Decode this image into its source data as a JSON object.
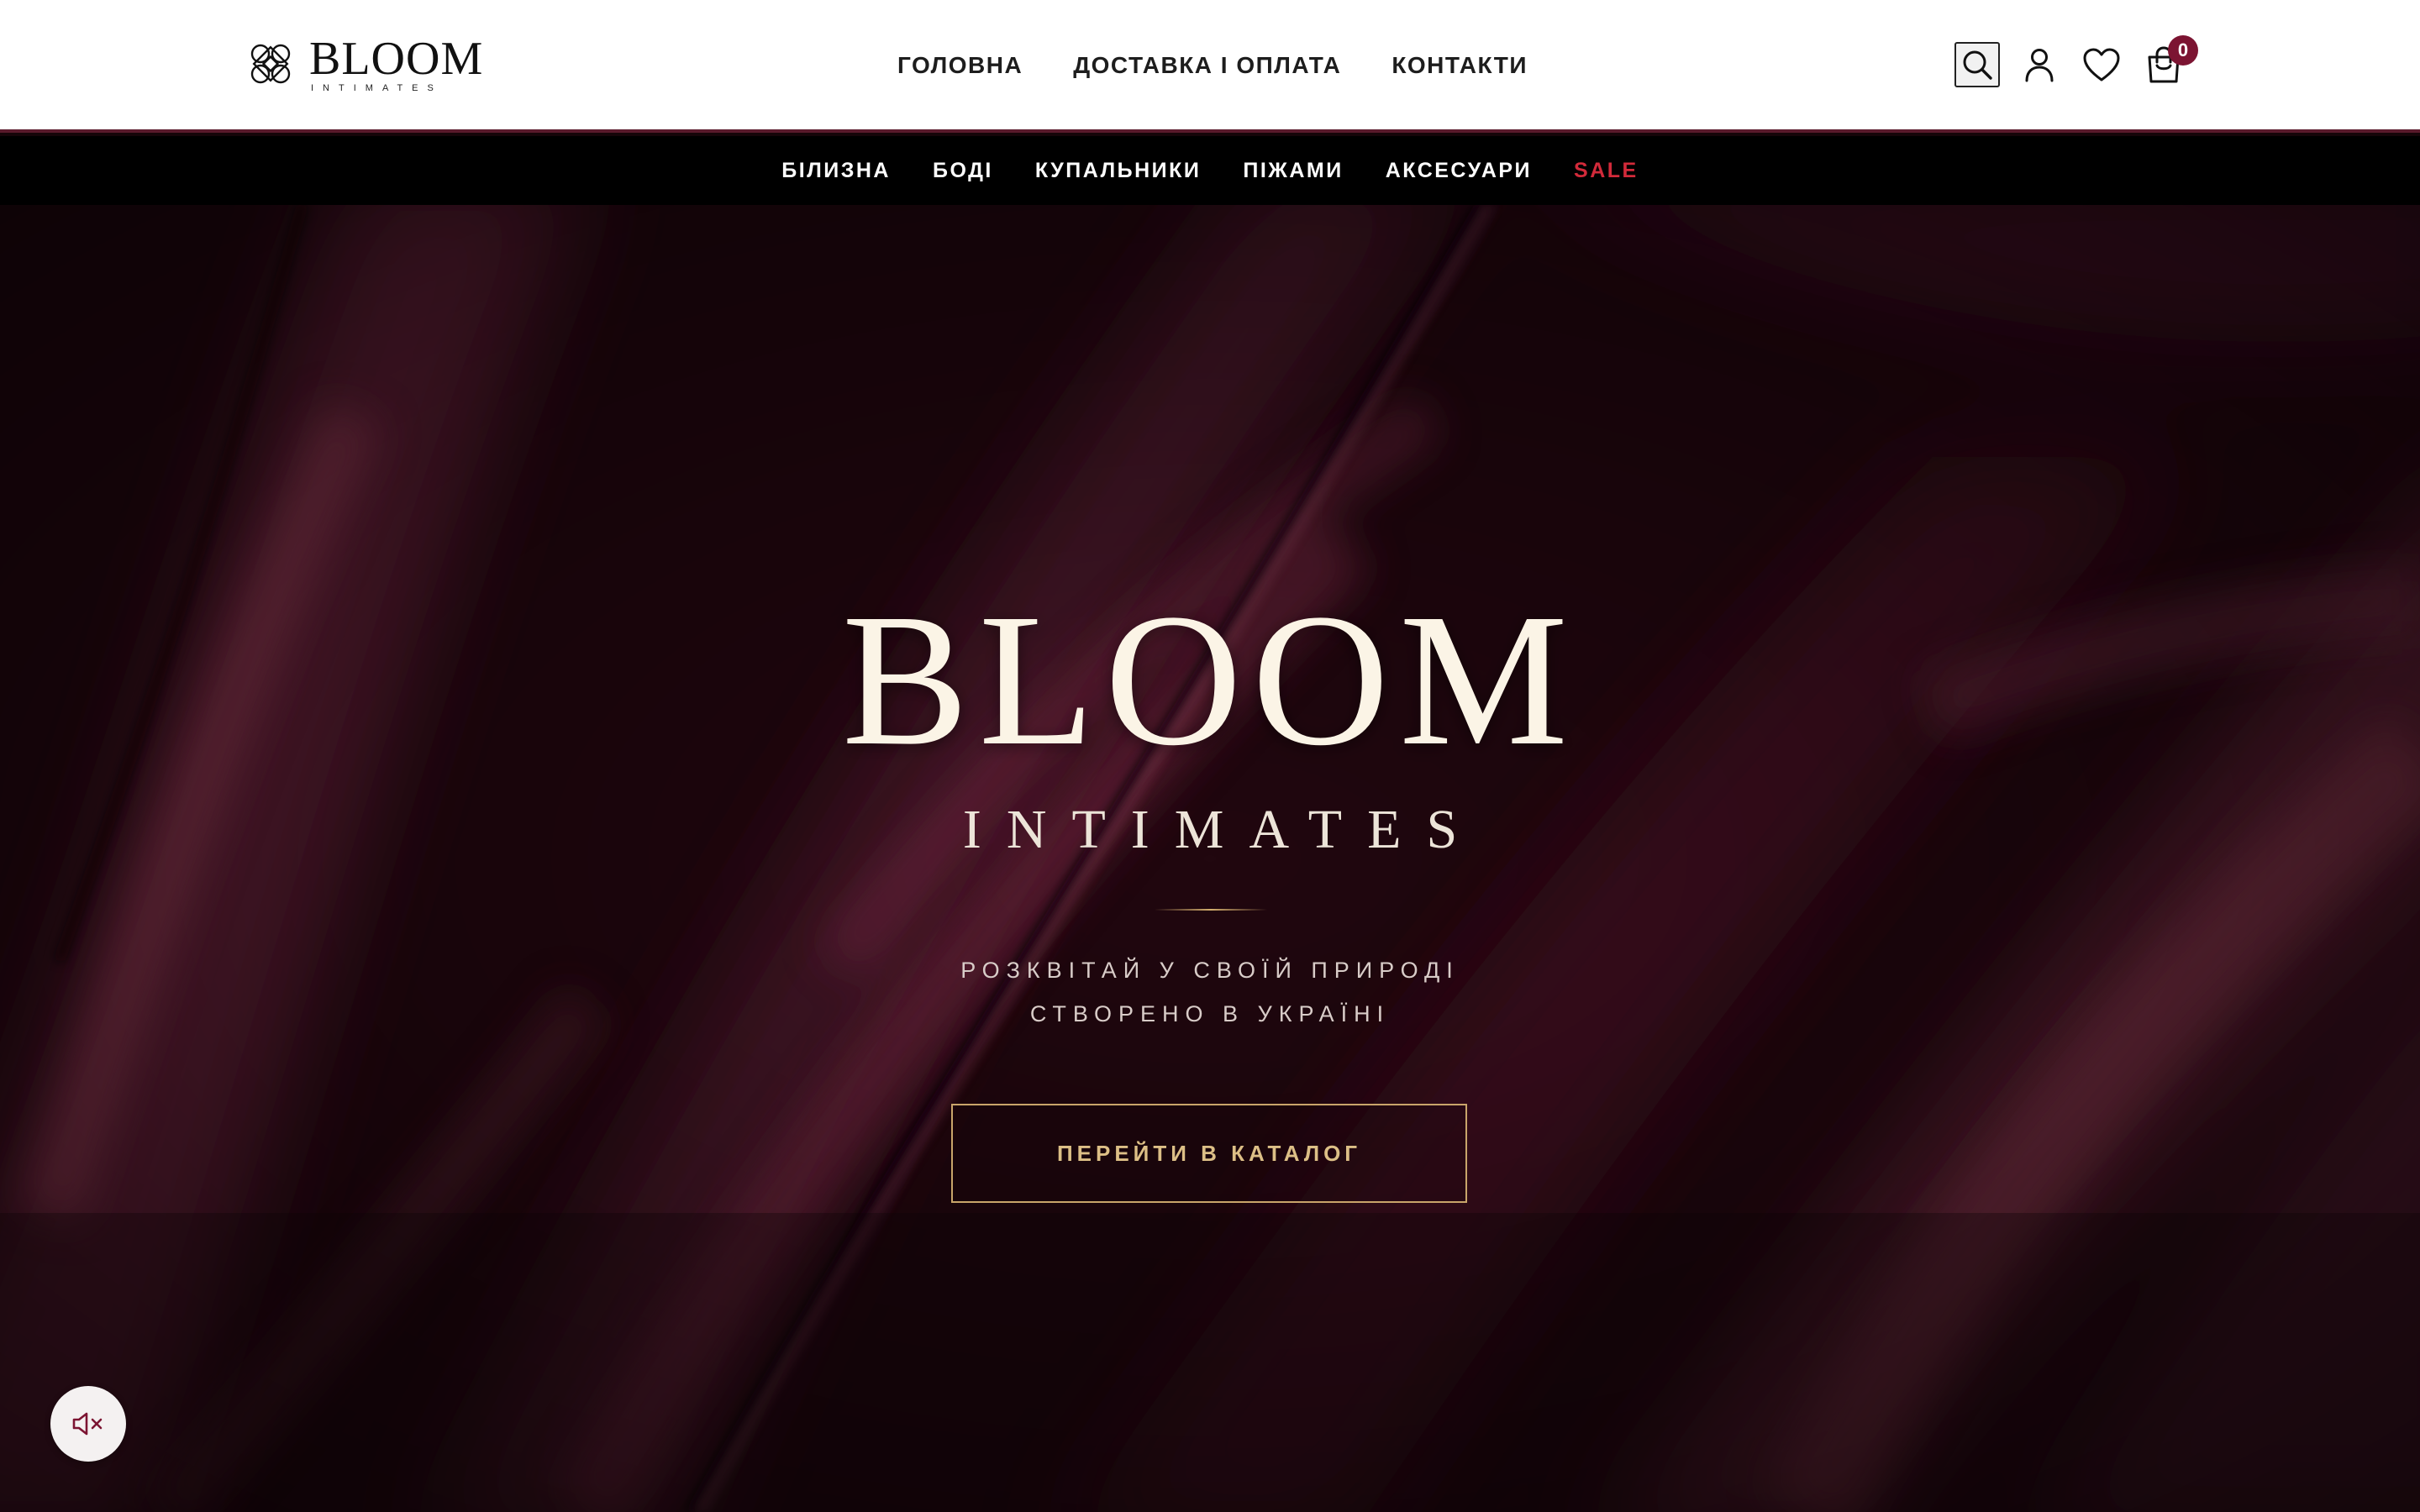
{
  "brand": {
    "name": "BLOOM",
    "sub": "INTIMATES"
  },
  "main_nav": [
    {
      "label": "ГОЛОВНА"
    },
    {
      "label": "ДОСТАВКА І ОПЛАТА"
    },
    {
      "label": "КОНТАКТИ"
    }
  ],
  "header_icons": {
    "search": "search-icon",
    "account": "user-icon",
    "wishlist": "heart-icon",
    "cart": "shopping-bag-icon",
    "cart_count": "0"
  },
  "categories": [
    {
      "label": "БІЛИЗНА"
    },
    {
      "label": "БОДІ"
    },
    {
      "label": "КУПАЛЬНИКИ"
    },
    {
      "label": "ПІЖАМИ"
    },
    {
      "label": "АКСЕСУАРИ"
    },
    {
      "label": "SALE"
    }
  ],
  "hero": {
    "title": "BLOOM",
    "subtitle": "INTIMATES",
    "tagline_1": "РОЗКВІТАЙ У СВОЇЙ ПРИРОДІ",
    "tagline_2": "СТВОРЕНО В УКРАЇНІ",
    "cta_label": "ПЕРЕЙТИ В КАТАЛОГ"
  },
  "sound_toggle": {
    "icon": "speaker-muted-icon"
  },
  "colors": {
    "accent": "#7c1432",
    "sale": "#d22a3a",
    "gold": "#c9a56a",
    "hero_bg": "#1a060c"
  }
}
